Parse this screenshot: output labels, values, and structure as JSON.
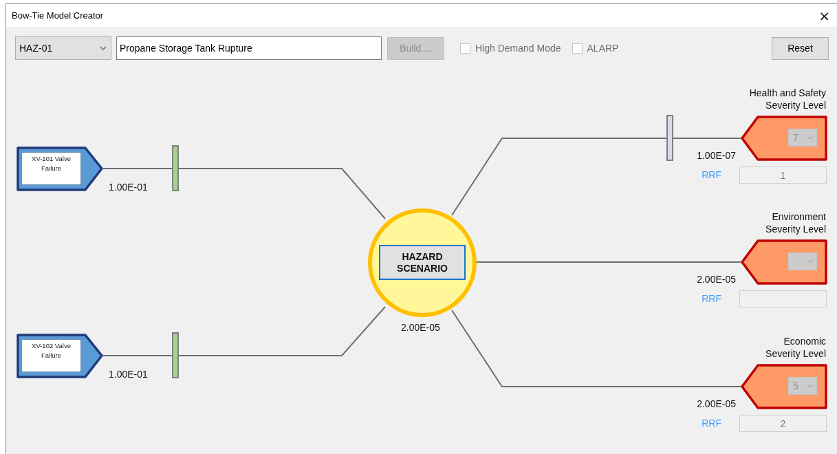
{
  "window": {
    "title": "Bow-Tie Model Creator",
    "close": "×"
  },
  "toolbar": {
    "hazard_select": {
      "value": "HAZ-01"
    },
    "description": {
      "value": "Propane Storage Tank Rupture"
    },
    "build_button": {
      "label": "Build....",
      "disabled": true
    },
    "checkboxes": [
      {
        "label": "High Demand Mode",
        "checked": false
      },
      {
        "label": "ALARP",
        "checked": false
      }
    ],
    "reset_button": {
      "label": "Reset"
    }
  },
  "diagram": {
    "threats": [
      {
        "label": "XV-101 Valve Failure",
        "probability": "1.00E-01",
        "barrier": {
          "color": "#a9d18e"
        }
      },
      {
        "label": "XV-102 Valve Failure",
        "probability": "1.00E-01",
        "barrier": {
          "color": "#a9d18e"
        }
      }
    ],
    "hazard": {
      "label": "HAZARD SCENARIO",
      "frequency": "2.00E-05"
    },
    "consequences": [
      {
        "title": "Health and Safety Severity Level",
        "severity": "7",
        "frequency": "1.00E-07",
        "rrf_label": "RRF",
        "rrf": "1",
        "barrier": {
          "color": "#d6dce5"
        }
      },
      {
        "title": "Environment Severity Level",
        "frequency": "2.00E-05",
        "rrf_label": "RRF"
      },
      {
        "title": "Economic Severity Level",
        "severity": "5",
        "frequency": "2.00E-05",
        "rrf_label": "RRF",
        "rrf": "2"
      }
    ]
  }
}
